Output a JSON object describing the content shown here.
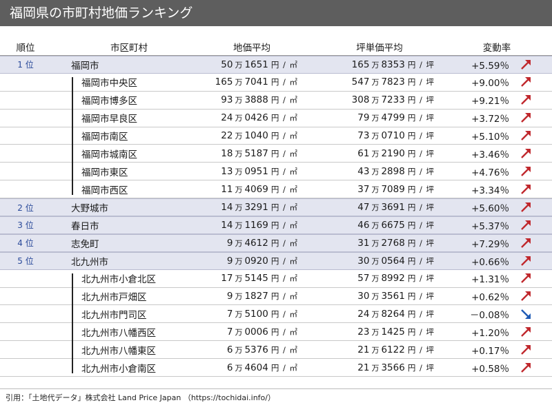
{
  "title": "福岡県の市町村地価ランキング",
  "columns": {
    "rank": "順位",
    "name": "市区町村",
    "avg": "地価平均",
    "tsubo": "坪単価平均",
    "change": "変動率"
  },
  "units": {
    "man": "万",
    "avg": "円 / ㎡",
    "tsubo": "円 / 坪"
  },
  "colors": {
    "up": "#c0282d",
    "down": "#1f5bb5",
    "accent": "#2a4a9a"
  },
  "rows": [
    {
      "rank": "1 位",
      "name": "福岡市",
      "avg_man": "50",
      "avg_rest": "1651",
      "tsubo_man": "165",
      "tsubo_rest": "8353",
      "change": "+5.59％",
      "trend": "up-arrow-icon"
    },
    {
      "name": "福岡市中央区",
      "avg_man": "165",
      "avg_rest": "7041",
      "tsubo_man": "547",
      "tsubo_rest": "7823",
      "change": "+9.00％",
      "trend": "up-arrow-icon"
    },
    {
      "name": "福岡市博多区",
      "avg_man": "93",
      "avg_rest": "3888",
      "tsubo_man": "308",
      "tsubo_rest": "7233",
      "change": "+9.21％",
      "trend": "up-arrow-icon"
    },
    {
      "name": "福岡市早良区",
      "avg_man": "24",
      "avg_rest": "0426",
      "tsubo_man": "79",
      "tsubo_rest": "4799",
      "change": "+3.72％",
      "trend": "up-arrow-icon"
    },
    {
      "name": "福岡市南区",
      "avg_man": "22",
      "avg_rest": "1040",
      "tsubo_man": "73",
      "tsubo_rest": "0710",
      "change": "+5.10％",
      "trend": "up-arrow-icon"
    },
    {
      "name": "福岡市城南区",
      "avg_man": "18",
      "avg_rest": "5187",
      "tsubo_man": "61",
      "tsubo_rest": "2190",
      "change": "+3.46％",
      "trend": "up-arrow-icon"
    },
    {
      "name": "福岡市東区",
      "avg_man": "13",
      "avg_rest": "0951",
      "tsubo_man": "43",
      "tsubo_rest": "2898",
      "change": "+4.76％",
      "trend": "up-arrow-icon"
    },
    {
      "name": "福岡市西区",
      "avg_man": "11",
      "avg_rest": "4069",
      "tsubo_man": "37",
      "tsubo_rest": "7089",
      "change": "+3.34％",
      "trend": "up-arrow-icon"
    },
    {
      "rank": "2 位",
      "name": "大野城市",
      "avg_man": "14",
      "avg_rest": "3291",
      "tsubo_man": "47",
      "tsubo_rest": "3691",
      "change": "+5.60％",
      "trend": "up-arrow-icon"
    },
    {
      "rank": "3 位",
      "name": "春日市",
      "avg_man": "14",
      "avg_rest": "1169",
      "tsubo_man": "46",
      "tsubo_rest": "6675",
      "change": "+5.37％",
      "trend": "up-arrow-icon"
    },
    {
      "rank": "4 位",
      "name": "志免町",
      "avg_man": "9",
      "avg_rest": "4612",
      "tsubo_man": "31",
      "tsubo_rest": "2768",
      "change": "+7.29％",
      "trend": "up-arrow-icon"
    },
    {
      "rank": "5 位",
      "name": "北九州市",
      "avg_man": "9",
      "avg_rest": "0920",
      "tsubo_man": "30",
      "tsubo_rest": "0564",
      "change": "+0.66％",
      "trend": "up-arrow-icon"
    },
    {
      "name": "北九州市小倉北区",
      "avg_man": "17",
      "avg_rest": "5145",
      "tsubo_man": "57",
      "tsubo_rest": "8992",
      "change": "+1.31％",
      "trend": "up-arrow-icon"
    },
    {
      "name": "北九州市戸畑区",
      "avg_man": "9",
      "avg_rest": "1827",
      "tsubo_man": "30",
      "tsubo_rest": "3561",
      "change": "+0.62％",
      "trend": "up-arrow-icon"
    },
    {
      "name": "北九州市門司区",
      "avg_man": "7",
      "avg_rest": "5100",
      "tsubo_man": "24",
      "tsubo_rest": "8264",
      "change": "－0.08％",
      "trend": "down-arrow-icon"
    },
    {
      "name": "北九州市八幡西区",
      "avg_man": "7",
      "avg_rest": "0006",
      "tsubo_man": "23",
      "tsubo_rest": "1425",
      "change": "+1.20％",
      "trend": "up-arrow-icon"
    },
    {
      "name": "北九州市八幡東区",
      "avg_man": "6",
      "avg_rest": "5376",
      "tsubo_man": "21",
      "tsubo_rest": "6122",
      "change": "+0.17％",
      "trend": "up-arrow-icon"
    },
    {
      "name": "北九州市小倉南区",
      "avg_man": "6",
      "avg_rest": "4604",
      "tsubo_man": "21",
      "tsubo_rest": "3566",
      "change": "+0.58％",
      "trend": "up-arrow-icon"
    }
  ],
  "footer": "引用：「土地代データ」株式会社 Land Price Japan （https://tochidai.info/）"
}
